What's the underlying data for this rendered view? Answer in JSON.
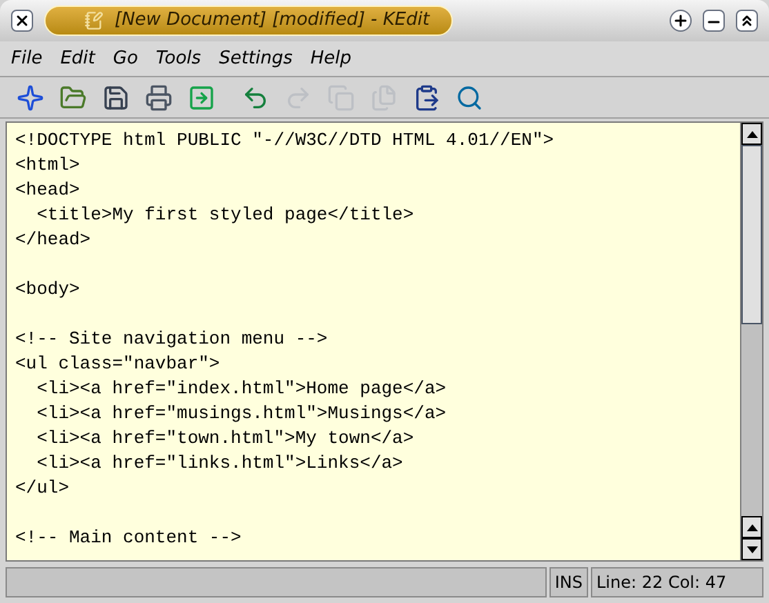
{
  "window": {
    "title": "[New Document] [modified] - KEdit"
  },
  "menu": [
    "File",
    "Edit",
    "Go",
    "Tools",
    "Settings",
    "Help"
  ],
  "toolbar": [
    {
      "kind": "new",
      "disabled": false
    },
    {
      "kind": "open",
      "disabled": false
    },
    {
      "kind": "save",
      "disabled": false
    },
    {
      "kind": "print",
      "disabled": false
    },
    {
      "kind": "send",
      "disabled": false
    },
    {
      "kind": "undo",
      "disabled": false
    },
    {
      "kind": "redo",
      "disabled": true
    },
    {
      "kind": "copy",
      "disabled": true
    },
    {
      "kind": "paste",
      "disabled": true
    },
    {
      "kind": "clipboard",
      "disabled": false
    },
    {
      "kind": "find",
      "disabled": false
    }
  ],
  "editor": {
    "lines": [
      {
        "kind": "code",
        "text": "<!DOCTYPE html PUBLIC \"-//W3C//DTD HTML 4.01//EN\">"
      },
      {
        "kind": "code",
        "text": "<html>"
      },
      {
        "kind": "code",
        "text": "<head>"
      },
      {
        "kind": "code",
        "text": "  <title>My first styled page</title>"
      },
      {
        "kind": "code",
        "text": "</head>"
      },
      {
        "kind": "blank"
      },
      {
        "kind": "code",
        "text": "<body>"
      },
      {
        "kind": "blank"
      },
      {
        "kind": "code",
        "text": "<!-- Site navigation menu -->"
      },
      {
        "kind": "code",
        "text": "<ul class=\"navbar\">"
      },
      {
        "kind": "code",
        "text": "  <li><a href=\"index.html\">Home page</a>"
      },
      {
        "kind": "code",
        "text": "  <li><a href=\"musings.html\">Musings</a>"
      },
      {
        "kind": "code",
        "text": "  <li><a href=\"town.html\">My town</a>"
      },
      {
        "kind": "code",
        "text": "  <li><a href=\"links.html\">Links</a>"
      },
      {
        "kind": "code",
        "text": "</ul>"
      },
      {
        "kind": "blank"
      },
      {
        "kind": "code",
        "text": "<!-- Main content -->"
      }
    ]
  },
  "status_bar": {
    "mode": "INS",
    "position": "Line: 22 Col: 47"
  }
}
